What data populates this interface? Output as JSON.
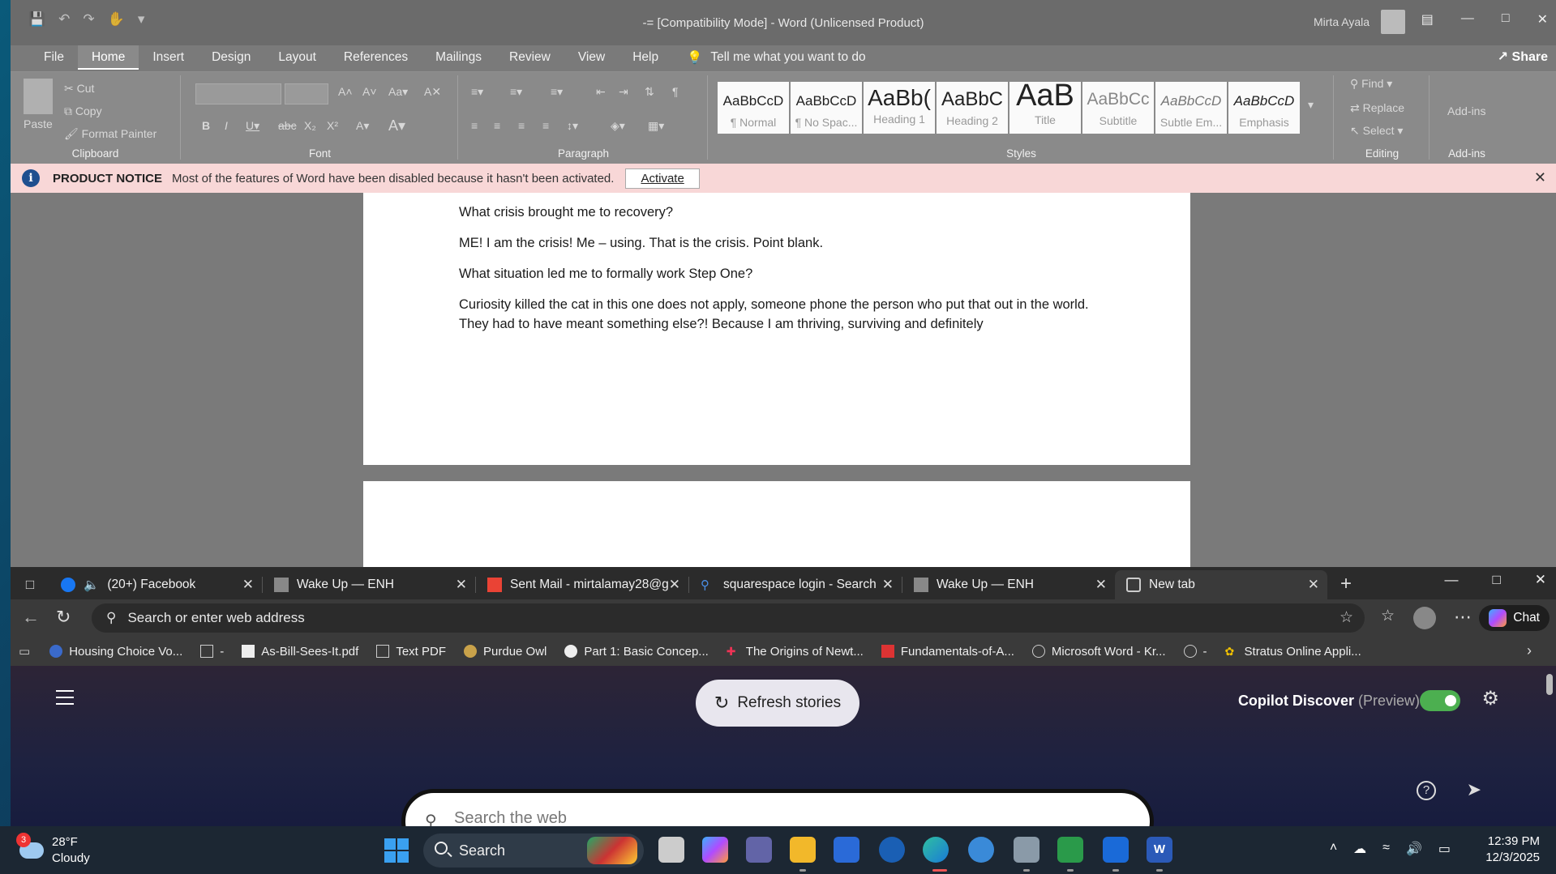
{
  "word": {
    "qat": [
      "save-icon",
      "undo-icon",
      "redo-icon",
      "touch-mode-icon",
      "customize-icon"
    ],
    "title": "-= [Compatibility Mode]  -  Word (Unlicensed Product)",
    "user": "Mirta Ayala",
    "tabs": [
      "File",
      "Home",
      "Insert",
      "Design",
      "Layout",
      "References",
      "Mailings",
      "Review",
      "View",
      "Help"
    ],
    "tell_me": "Tell me what you want to do",
    "share": "Share",
    "clipboard": {
      "paste": "Paste",
      "cut": "Cut",
      "copy": "Copy",
      "format_painter": "Format Painter",
      "label": "Clipboard"
    },
    "font_label": "Font",
    "paragraph_label": "Paragraph",
    "styles_label": "Styles",
    "styles": [
      {
        "sample": "AaBbCcD",
        "name": "¶ Normal"
      },
      {
        "sample": "AaBbCcD",
        "name": "¶ No Spac..."
      },
      {
        "sample": "AaBb(",
        "name": "Heading 1"
      },
      {
        "sample": "AaBbC",
        "name": "Heading 2"
      },
      {
        "sample": "AaB",
        "name": "Title"
      },
      {
        "sample": "AaBbCc",
        "name": "Subtitle"
      },
      {
        "sample": "AaBbCcD",
        "name": "Subtle Em..."
      },
      {
        "sample": "AaBbCcD",
        "name": "Emphasis"
      }
    ],
    "editing": {
      "find": "Find",
      "replace": "Replace",
      "select": "Select",
      "label": "Editing"
    },
    "addins": {
      "btn": "Add-ins",
      "label": "Add-ins"
    },
    "notice": {
      "title": "PRODUCT NOTICE",
      "text": "Most of the features of Word have been disabled because it hasn't been activated.",
      "button": "Activate"
    },
    "document": [
      "What crisis brought me to recovery?",
      "ME! I am the crisis! Me – using. That is the crisis. Point blank.",
      "What situation led me to formally work Step One?",
      "Curiosity killed the cat in this one does not apply, someone phone the person who put that out in the world. They had to have meant something else?! Because I am thriving, surviving and definitely"
    ]
  },
  "edge": {
    "tabs": [
      {
        "label": "(20+) Facebook",
        "icon": "facebook-icon"
      },
      {
        "label": "Wake Up — ENH",
        "icon": "page-icon"
      },
      {
        "label": "Sent Mail - mirtalamay28@g",
        "icon": "gmail-icon"
      },
      {
        "label": "squarespace login - Search",
        "icon": "search-icon"
      },
      {
        "label": "Wake Up — ENH",
        "icon": "page-icon"
      },
      {
        "label": "New tab",
        "icon": "newtab-icon"
      }
    ],
    "address_placeholder": "Search or enter web address",
    "chat": "Chat",
    "favorites": [
      "Housing Choice Vo...",
      "-",
      "As-Bill-Sees-It.pdf",
      "Text PDF",
      "Purdue Owl",
      "Part 1: Basic Concep...",
      "The Origins of Newt...",
      "Fundamentals-of-A...",
      "Microsoft Word - Kr...",
      "-",
      "Stratus Online Appli..."
    ],
    "refresh": "Refresh stories",
    "discover_title": "Copilot Discover",
    "discover_preview": "(Preview)",
    "search_placeholder": "Search the web"
  },
  "taskbar": {
    "temp": "28°F",
    "condition": "Cloudy",
    "badge": "3",
    "search": "Search",
    "time": "12:39 PM",
    "date": "12/3/2025"
  }
}
